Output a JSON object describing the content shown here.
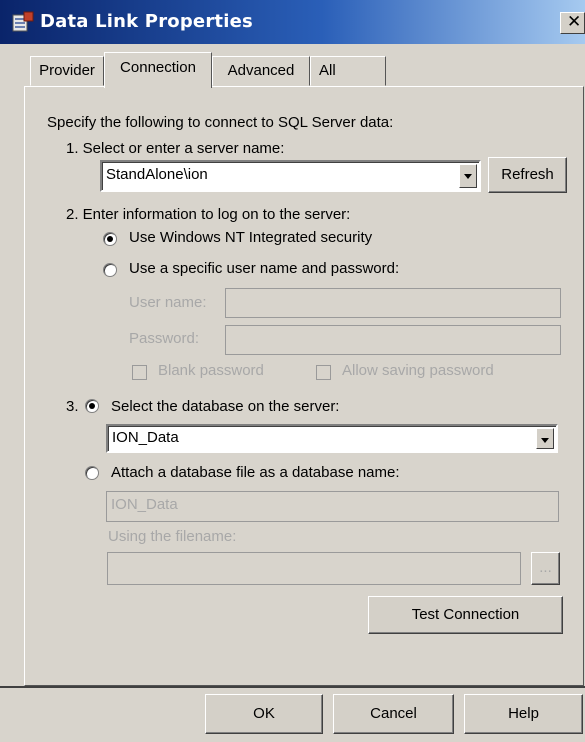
{
  "window": {
    "title": "Data Link Properties",
    "close_glyph": "✕"
  },
  "tabs": [
    {
      "label": "Provider",
      "active": false
    },
    {
      "label": "Connection",
      "active": true
    },
    {
      "label": "Advanced",
      "active": false
    },
    {
      "label": "All",
      "active": false
    }
  ],
  "connection": {
    "intro": "Specify the following to connect to SQL Server data:",
    "step1": {
      "label": "1. Select or enter a server name:",
      "server_value": "StandAlone\\ion",
      "refresh_label": "Refresh"
    },
    "step2": {
      "label": "2. Enter information to log on to the server:",
      "option_nt": "Use Windows NT Integrated security",
      "option_specific": "Use a specific user name and password:",
      "selected": "nt",
      "username_label": "User name:",
      "username_value": "",
      "password_label": "Password:",
      "password_value": "",
      "blank_password_label": "Blank password",
      "allow_saving_label": "Allow saving password"
    },
    "step3": {
      "number": "3.",
      "option_select": "Select the database on the server:",
      "database_value": "ION_Data",
      "option_attach": "Attach a database file as a database name:",
      "attach_name_value": "ION_Data",
      "filename_label": "Using the filename:",
      "filename_value": "",
      "browse_label": "...",
      "selected": "select"
    },
    "test_connection_label": "Test Connection"
  },
  "footer": {
    "ok": "OK",
    "cancel": "Cancel",
    "help": "Help"
  }
}
